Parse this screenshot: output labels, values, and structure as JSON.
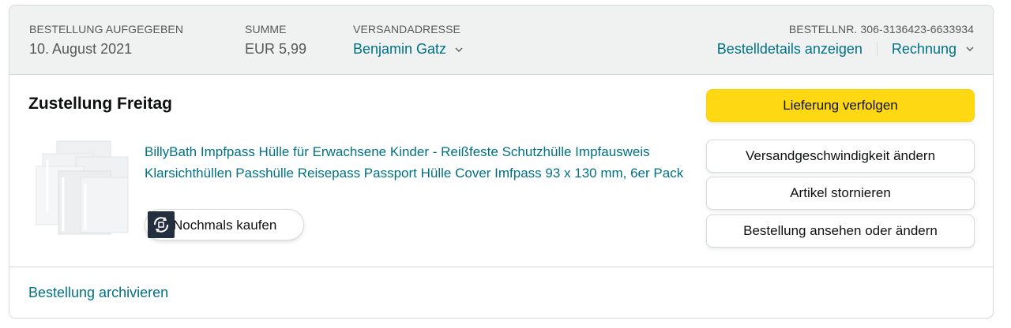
{
  "header": {
    "order_placed": {
      "label": "BESTELLUNG AUFGEGEBEN",
      "value": "10. August 2021"
    },
    "total": {
      "label": "SUMME",
      "value": "EUR 5,99"
    },
    "ship_to": {
      "label": "VERSANDADRESSE",
      "value": "Benjamin Gatz"
    },
    "order_number": "BESTELLNR. 306-3136423-6633934",
    "order_details_link": "Bestelldetails anzeigen",
    "invoice_link": "Rechnung"
  },
  "shipment": {
    "title": "Zustellung Freitag",
    "product_title": "BillyBath Impfpass Hülle für Erwachsene Kinder - Reißfeste Schutzhülle Impfausweis Klarsichthüllen Passhülle Reisepass Passport Hülle Cover Imfpass 93 x 130 mm, 6er Pack",
    "product_image_icon": "product-image",
    "buy_again_label": "Nochmals kaufen",
    "buy_again_icon": "refresh-cart-icon"
  },
  "actions": {
    "track": "Lieferung verfolgen",
    "change_speed": "Versandgeschwindigkeit ändern",
    "cancel": "Artikel stornieren",
    "view_edit": "Bestellung ansehen oder ändern"
  },
  "footer": {
    "archive_link": "Bestellung archivieren"
  },
  "colors": {
    "link": "#007185",
    "header_bg": "#f0f2f2",
    "primary_button": "#ffd814",
    "border": "#d5d9d9",
    "text": "#0f1111",
    "muted_text": "#565959"
  }
}
